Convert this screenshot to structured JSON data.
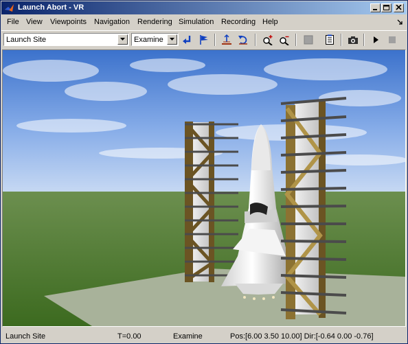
{
  "window": {
    "title": "Launch Abort - VR"
  },
  "menu": [
    "File",
    "View",
    "Viewpoints",
    "Navigation",
    "Rendering",
    "Simulation",
    "Recording",
    "Help"
  ],
  "toolbar": {
    "viewpoint_select": "Launch Site",
    "nav_mode_select": "Examine"
  },
  "status": {
    "viewpoint": "Launch Site",
    "time": "T=0.00",
    "mode": "Examine",
    "posdir": "Pos:[6.00 3.50 10.00] Dir:[-0.64 0.00 -0.76]"
  },
  "colors": {
    "title_start": "#0a246a",
    "title_end": "#a6caf0",
    "sky_top": "#3a6fc8",
    "ground": "#4e7a2f",
    "pad": "#a8b29a",
    "tower_frame": "#6b5423"
  }
}
